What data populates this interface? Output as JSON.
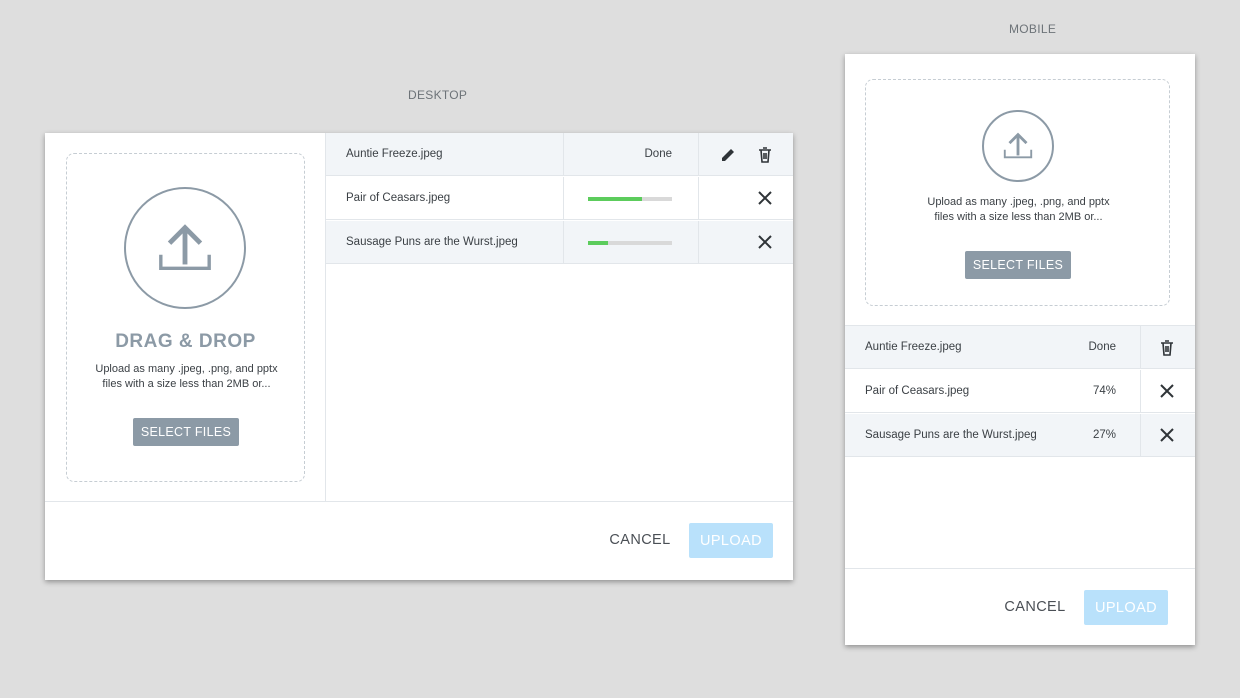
{
  "captions": {
    "desktop": "DESKTOP",
    "mobile": "MOBILE"
  },
  "colors": {
    "accent_gray": "#8c9aa6",
    "upload_disabled": "#b9e1fb",
    "progress": "#5ccc5c",
    "background": "#dedede"
  },
  "icons": {
    "upload": "upload-arrow-icon",
    "edit": "pencil-icon",
    "delete": "trash-icon",
    "cancel": "close-icon"
  },
  "desktop": {
    "drop_title": "DRAG & DROP",
    "drop_text_line1": "Upload as many .jpeg, .png, and pptx",
    "drop_text_line2": "files with a size less than 2MB or...",
    "select_label": "SELECT FILES",
    "files": [
      {
        "name": "Auntie Freeze.jpeg",
        "status": "Done",
        "progress": 1.0
      },
      {
        "name": "Pair of Ceasars.jpeg",
        "status": "",
        "progress": 0.64
      },
      {
        "name": "Sausage Puns are the Wurst.jpeg",
        "status": "",
        "progress": 0.24
      }
    ],
    "cancel_label": "CANCEL",
    "upload_label": "UPLOAD"
  },
  "mobile": {
    "drop_text_line1": "Upload as many .jpeg, .png, and pptx",
    "drop_text_line2": "files with a size less than 2MB or...",
    "select_label": "SELECT FILES",
    "files": [
      {
        "name": "Auntie Freeze.jpeg",
        "status": "Done"
      },
      {
        "name": "Pair of Ceasars.jpeg",
        "status": "74%"
      },
      {
        "name": "Sausage Puns are the Wurst.jpeg",
        "status": "27%"
      }
    ],
    "cancel_label": "CANCEL",
    "upload_label": "UPLOAD"
  }
}
